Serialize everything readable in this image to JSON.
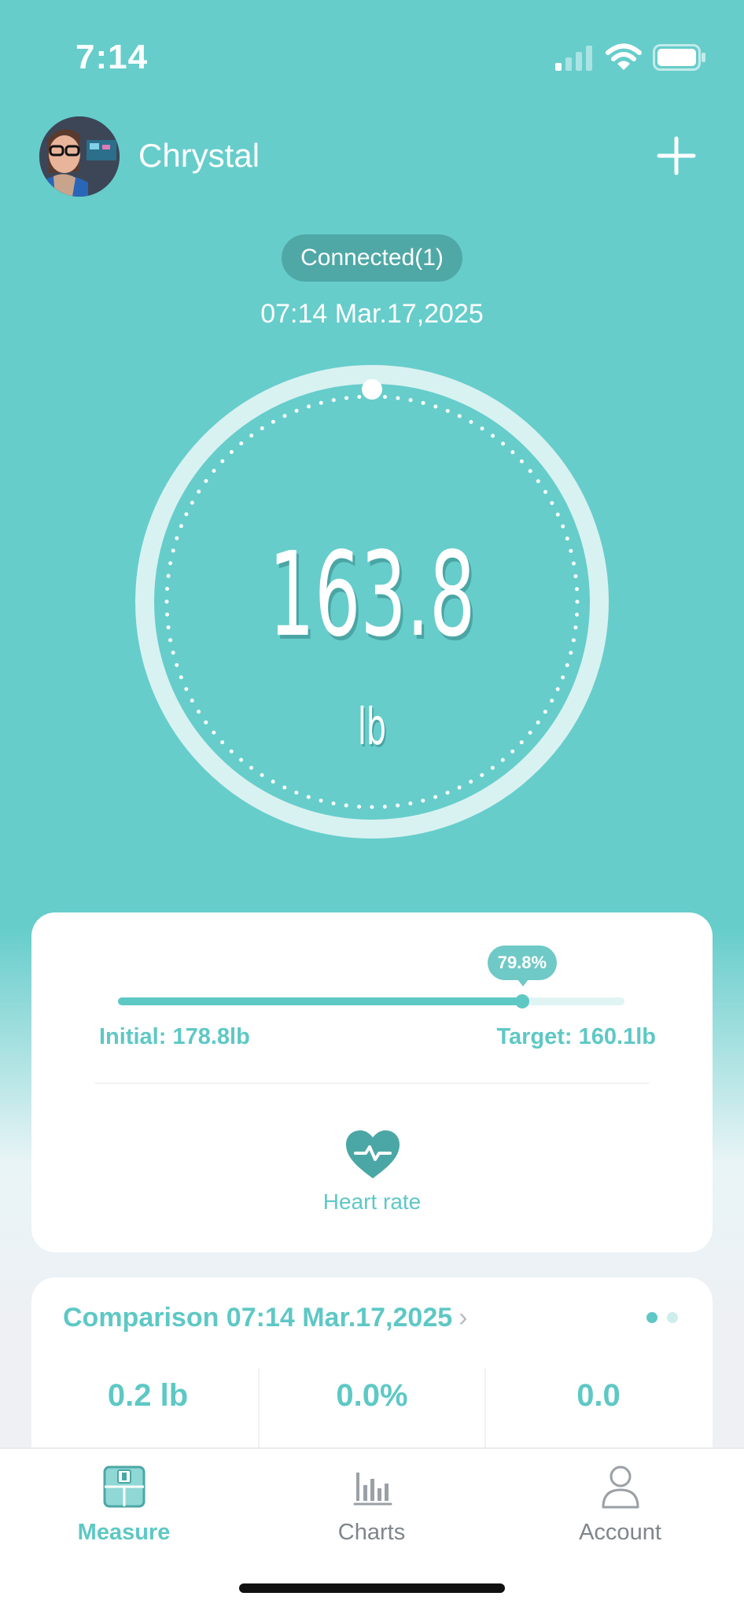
{
  "status_bar": {
    "time": "7:14",
    "icons": [
      "cellular-signal-icon",
      "wifi-icon",
      "battery-icon"
    ]
  },
  "header": {
    "user_name": "Chrystal",
    "add_icon": "plus-icon"
  },
  "connection": {
    "status": "Connected(1)",
    "timestamp": "07:14 Mar.17,2025"
  },
  "measurement": {
    "weight": "163.8",
    "unit": "lb"
  },
  "progress": {
    "percent_label": "79.8%",
    "percent": 79.8,
    "initial": "Initial: 178.8lb",
    "target": "Target: 160.1lb",
    "heart_rate_icon": "heart-pulse-icon",
    "heart_rate_label": "Heart rate"
  },
  "comparison": {
    "title": "Comparison 07:14 Mar.17,2025",
    "chevron": "›",
    "pages": 2,
    "active_page": 1,
    "values": [
      "0.2 lb",
      "0.0%",
      "0.0"
    ]
  },
  "tabs": [
    {
      "label": "Measure",
      "icon": "scale-icon",
      "active": true
    },
    {
      "label": "Charts",
      "icon": "bar-chart-icon",
      "active": false
    },
    {
      "label": "Account",
      "icon": "person-icon",
      "active": false
    }
  ],
  "colors": {
    "primary": "#66cdcb",
    "accent_text": "#5ec8c5",
    "pill": "#4fa8a6",
    "inactive_tab": "#7f858c"
  }
}
